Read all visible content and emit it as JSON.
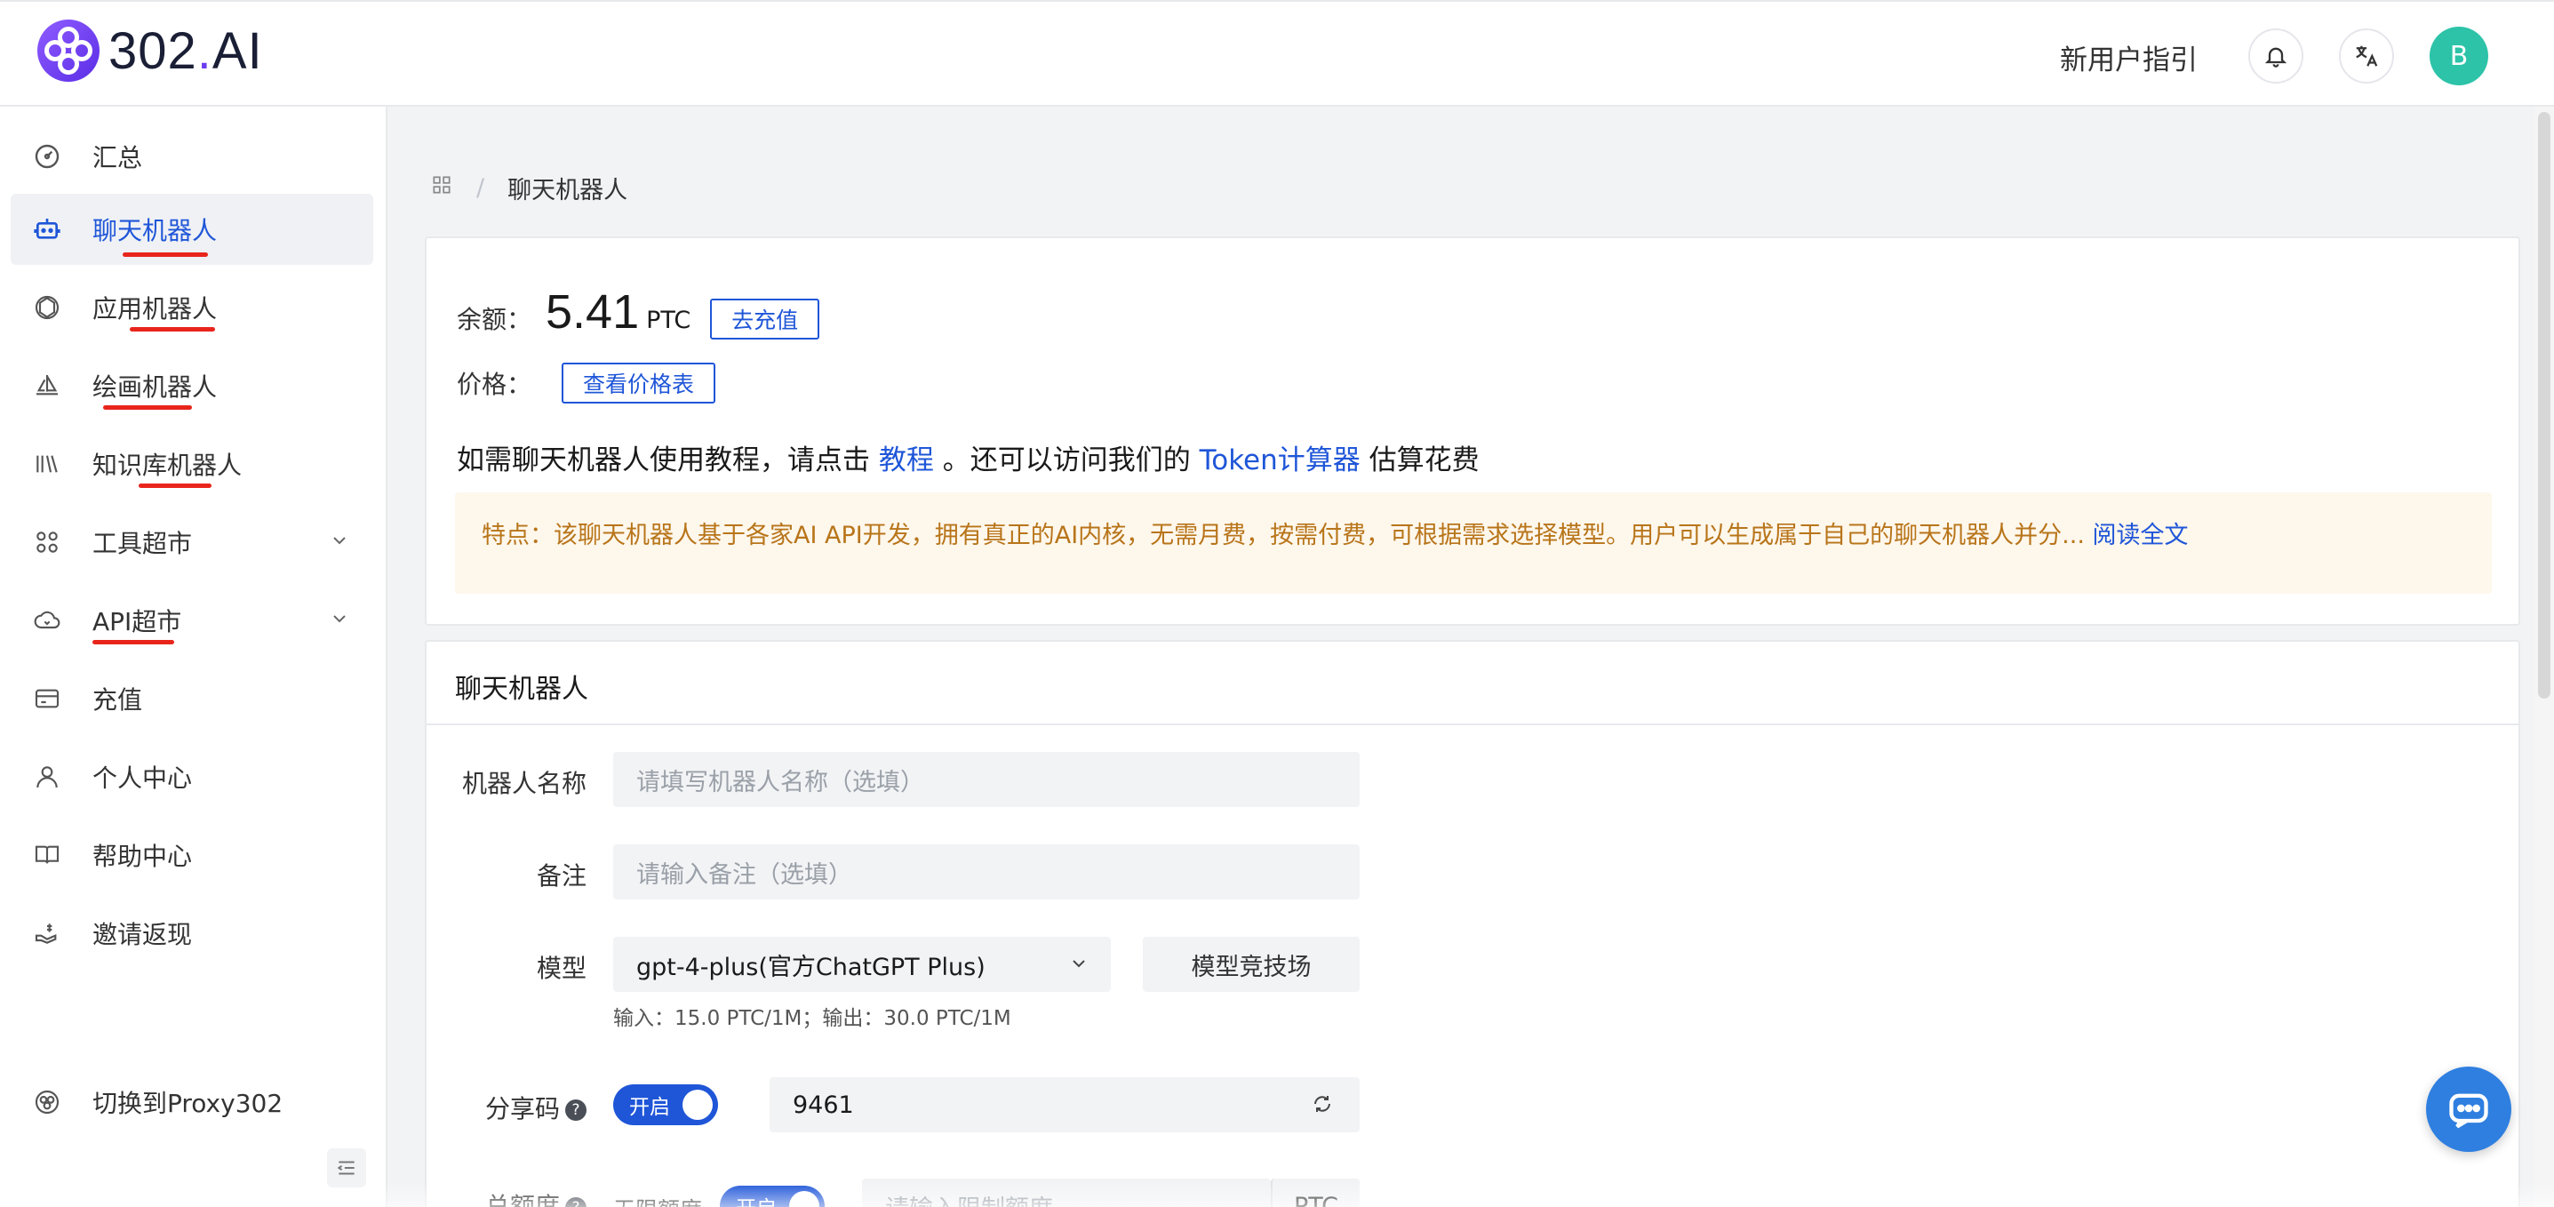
{
  "header": {
    "logo_text_main": "302",
    "logo_text_dot": ".",
    "logo_text_end": "AI",
    "guide": "新用户指引",
    "avatar_letter": "B"
  },
  "sidebar": {
    "items": [
      {
        "label": "汇总",
        "icon": "dashboard-icon"
      },
      {
        "label": "聊天机器人",
        "icon": "robot-icon",
        "active": true
      },
      {
        "label": "应用机器人",
        "icon": "openai-icon"
      },
      {
        "label": "绘画机器人",
        "icon": "sailboat-icon"
      },
      {
        "label": "知识库机器人",
        "icon": "books-icon"
      },
      {
        "label": "工具超市",
        "icon": "grid-icon",
        "expandable": true
      },
      {
        "label": "API超市",
        "icon": "cloud-icon",
        "expandable": true
      },
      {
        "label": "充值",
        "icon": "card-icon"
      },
      {
        "label": "个人中心",
        "icon": "user-icon"
      },
      {
        "label": "帮助中心",
        "icon": "book-icon"
      },
      {
        "label": "邀请返现",
        "icon": "cashback-icon"
      }
    ],
    "switch_label": "切换到Proxy302"
  },
  "breadcrumb": {
    "current": "聊天机器人"
  },
  "balance": {
    "label": "余额：",
    "value": "5.41",
    "unit": "PTC",
    "recharge_btn": "去充值",
    "price_label": "价格：",
    "price_btn": "查看价格表"
  },
  "tutorial": {
    "prefix": "如需聊天机器人使用教程，请点击 ",
    "link1": "教程",
    "middle": " 。还可以访问我们的 ",
    "link2": "Token计算器",
    "suffix": " 估算花费"
  },
  "notice": {
    "text": "特点：该聊天机器人基于各家AI API开发，拥有真正的AI内核，无需月费，按需付费，可根据需求选择模型。用户可以生成属于自己的聊天机器人并分... ",
    "link": "阅读全文"
  },
  "form": {
    "title": "聊天机器人",
    "name_label": "机器人名称",
    "name_placeholder": "请填写机器人名称（选填）",
    "note_label": "备注",
    "note_placeholder": "请输入备注（选填）",
    "model_label": "模型",
    "model_value": "gpt-4-plus(官方ChatGPT Plus)",
    "arena_btn": "模型竞技场",
    "model_hint": "输入：15.0 PTC/1M；输出：30.0 PTC/1M",
    "share_label": "分享码",
    "share_toggle": "开启",
    "share_code": "9461",
    "quota_label": "总额度",
    "unlimited_label": "无限额度",
    "unlimited_toggle": "开启",
    "quota_placeholder": "请输入限制额度",
    "quota_unit": "PTC"
  },
  "colors": {
    "accent": "#1f56d8",
    "notice_bg": "#fef7ec",
    "notice_text": "#b8751a",
    "avatar": "#2cc3a8",
    "underline": "#e8251c"
  }
}
